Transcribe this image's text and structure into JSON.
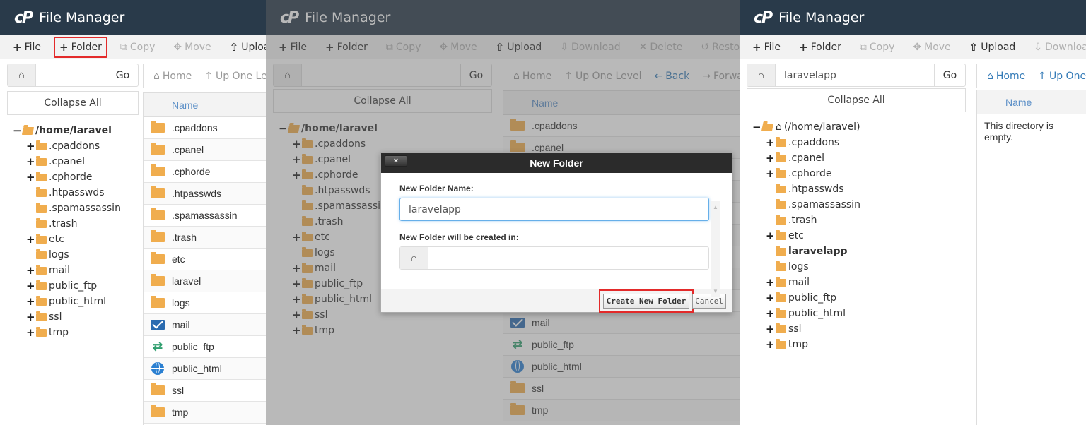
{
  "app": {
    "logo": "cP",
    "title": "File Manager"
  },
  "colors": {
    "header_bg": "#293a4a",
    "folder": "#f0ad4e",
    "link": "#337ab7",
    "highlight": "#e32a2a"
  },
  "toolbar": {
    "file": "File",
    "folder": "Folder",
    "copy": "Copy",
    "move": "Move",
    "upload": "Upload",
    "download": "Download",
    "delete": "Delete",
    "restore": "Restore"
  },
  "nav": {
    "home": "Home",
    "up": "Up One Level",
    "back": "Back",
    "forward": "Forward"
  },
  "path": {
    "go": "Go",
    "panel1_value": "",
    "panel2_value": "",
    "panel3_value": "laravelapp"
  },
  "collapse_all": "Collapse All",
  "file_list": {
    "column_name": "Name",
    "items": [
      {
        "name": ".cpaddons",
        "icon": "folder-icon"
      },
      {
        "name": ".cpanel",
        "icon": "folder-icon"
      },
      {
        "name": ".cphorde",
        "icon": "folder-icon"
      },
      {
        "name": ".htpasswds",
        "icon": "folder-icon"
      },
      {
        "name": ".spamassassin",
        "icon": "folder-icon"
      },
      {
        "name": ".trash",
        "icon": "folder-icon"
      },
      {
        "name": "etc",
        "icon": "folder-icon"
      },
      {
        "name": "laravel",
        "icon": "folder-icon"
      },
      {
        "name": "logs",
        "icon": "folder-icon"
      },
      {
        "name": "mail",
        "icon": "mail-icon"
      },
      {
        "name": "public_ftp",
        "icon": "exchange-icon"
      },
      {
        "name": "public_html",
        "icon": "globe-icon"
      },
      {
        "name": "ssl",
        "icon": "folder-icon"
      },
      {
        "name": "tmp",
        "icon": "folder-icon"
      }
    ],
    "empty_message": "This directory is empty."
  },
  "tree": {
    "root_label": "/home/laravel",
    "root_label_home": "(/home/laravel)",
    "children": [
      {
        "name": ".cpaddons",
        "expandable": true
      },
      {
        "name": ".cpanel",
        "expandable": true
      },
      {
        "name": ".cphorde",
        "expandable": true
      },
      {
        "name": ".htpasswds",
        "expandable": false
      },
      {
        "name": ".spamassassin",
        "expandable": false
      },
      {
        "name": ".trash",
        "expandable": false
      },
      {
        "name": "etc",
        "expandable": true
      },
      {
        "name": "logs",
        "expandable": false
      },
      {
        "name": "mail",
        "expandable": true
      },
      {
        "name": "public_ftp",
        "expandable": true
      },
      {
        "name": "public_html",
        "expandable": true
      },
      {
        "name": "ssl",
        "expandable": true
      },
      {
        "name": "tmp",
        "expandable": true
      }
    ],
    "children_after": [
      {
        "name": ".cpaddons",
        "expandable": true
      },
      {
        "name": ".cpanel",
        "expandable": true
      },
      {
        "name": ".cphorde",
        "expandable": true
      },
      {
        "name": ".htpasswds",
        "expandable": false
      },
      {
        "name": ".spamassassin",
        "expandable": false
      },
      {
        "name": ".trash",
        "expandable": false
      },
      {
        "name": "etc",
        "expandable": true
      },
      {
        "name": "laravelapp",
        "expandable": false,
        "bold": true
      },
      {
        "name": "logs",
        "expandable": false
      },
      {
        "name": "mail",
        "expandable": true
      },
      {
        "name": "public_ftp",
        "expandable": true
      },
      {
        "name": "public_html",
        "expandable": true
      },
      {
        "name": "ssl",
        "expandable": true
      },
      {
        "name": "tmp",
        "expandable": true
      }
    ]
  },
  "dialog": {
    "title": "New Folder",
    "close": "×",
    "name_label": "New Folder Name:",
    "name_value": "laravelapp",
    "location_label": "New Folder will be created in:",
    "location_value": "",
    "create_button": "Create New Folder",
    "cancel_button": "Cancel"
  }
}
